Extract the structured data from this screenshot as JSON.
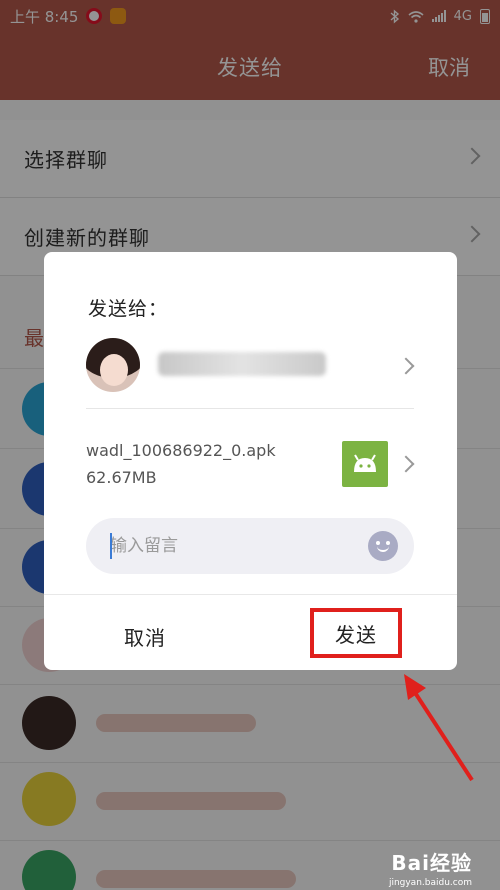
{
  "status_bar": {
    "time": "上午 8:45",
    "network": "4G"
  },
  "nav": {
    "title": "发送给",
    "cancel": "取消"
  },
  "list": {
    "select_group": "选择群聊",
    "create_group": "创建新的群聊",
    "recent_label": "最"
  },
  "dialog": {
    "title": "发送给：",
    "file_name": "wadl_100686922_0.apk",
    "file_size": "62.67MB",
    "message_placeholder": "输入留言",
    "cancel": "取消",
    "send": "发送"
  },
  "icons": {
    "weibo": "weibo-icon",
    "app_badge": "app-badge-icon",
    "bluetooth": "bluetooth-icon",
    "wifi": "wifi-icon",
    "signal": "signal-icon",
    "battery": "battery-icon",
    "android": "android-icon",
    "emoji": "emoji-icon",
    "chevron": "chevron-right-icon"
  },
  "colors": {
    "header": "#b4584a",
    "highlight": "#e0201c",
    "android": "#7cb342"
  },
  "watermark": {
    "brand": "Bai经验",
    "site": "jingyan.baidu.com"
  }
}
